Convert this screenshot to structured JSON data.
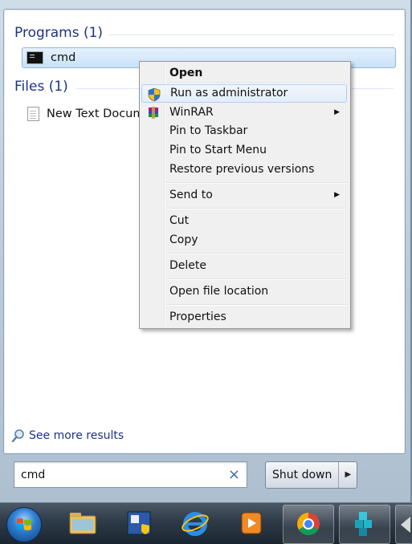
{
  "start_menu": {
    "programs_header": "Programs (1)",
    "program_item": "cmd",
    "files_header": "Files (1)",
    "file_item": "New Text Docum",
    "see_more": "See more results",
    "search_value": "cmd",
    "clear_symbol": "×",
    "shutdown_label": "Shut down",
    "shutdown_arrow": "▶"
  },
  "context_menu": {
    "items": [
      {
        "label": "Open"
      },
      {
        "label": "Run as administrator"
      },
      {
        "label": "WinRAR"
      },
      {
        "label": "Pin to Taskbar"
      },
      {
        "label": "Pin to Start Menu"
      },
      {
        "label": "Restore previous versions"
      },
      {
        "label": "Send to"
      },
      {
        "label": "Cut"
      },
      {
        "label": "Copy"
      },
      {
        "label": "Delete"
      },
      {
        "label": "Open file location"
      },
      {
        "label": "Properties"
      }
    ],
    "submenu_arrow": "▶"
  },
  "taskbar": {
    "icons": [
      "start-orb-icon",
      "file-explorer-icon",
      "app-icon",
      "internet-explorer-icon",
      "media-player-icon",
      "chrome-icon",
      "puzzle-app-icon",
      "partial-app-icon"
    ]
  },
  "colors": {
    "header_blue": "#1e3287",
    "selection": "#c9e1f8",
    "menu_bg": "#f0f0f0"
  }
}
